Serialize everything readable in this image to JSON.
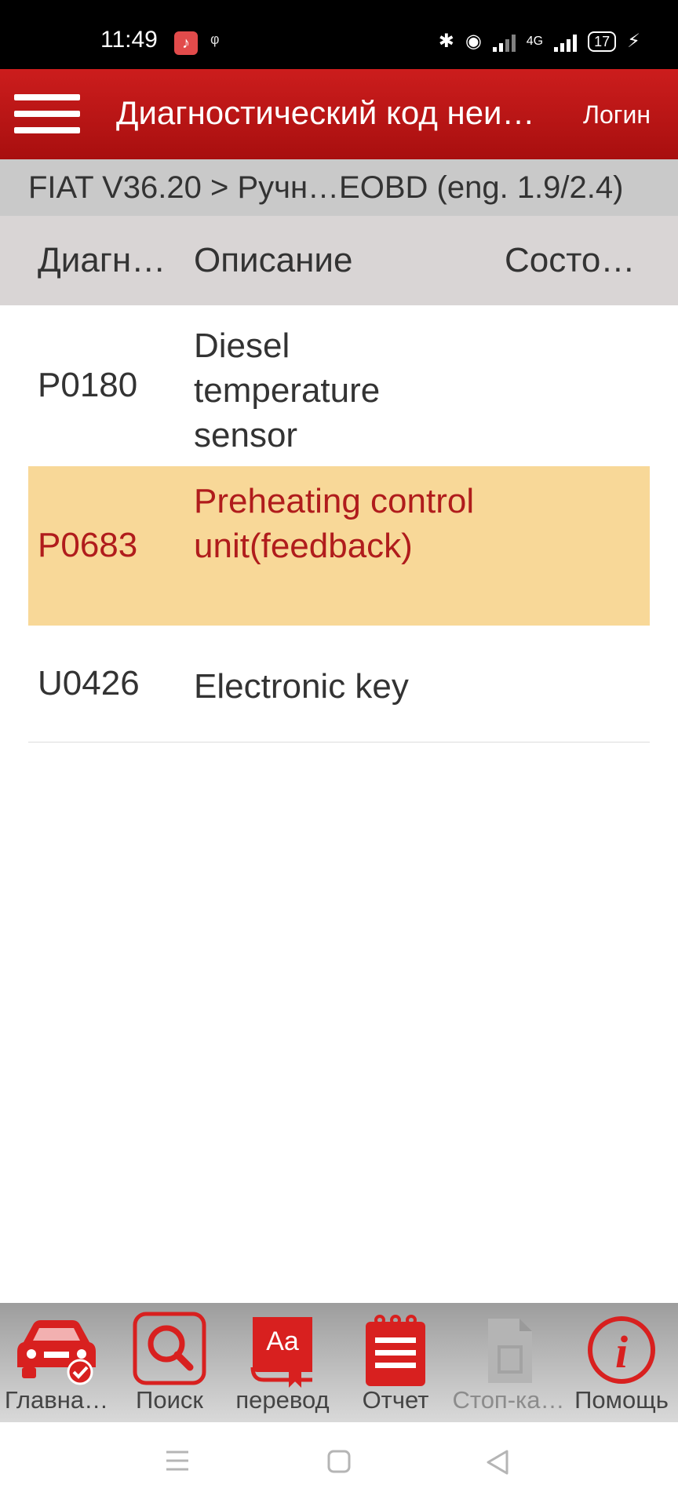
{
  "status_bar": {
    "time": "11:49",
    "network": "4G",
    "battery": "17"
  },
  "header": {
    "title": "Диагностический код неи…",
    "login_label": "Логин"
  },
  "breadcrumb": "FIAT V36.20 > Ручн…EOBD (eng. 1.9/2.4)",
  "table": {
    "columns": [
      "Диагн…",
      "Описание",
      "Состо…"
    ],
    "rows": [
      {
        "code": "P0180",
        "description": "Diesel temperature sensor",
        "status": ""
      },
      {
        "code": "P0683",
        "description": "Preheating control unit(feedback)",
        "status": "",
        "selected": true
      },
      {
        "code": "U0426",
        "description": "Electronic key",
        "status": ""
      }
    ]
  },
  "toolbar": {
    "items": [
      {
        "label": "Главна…",
        "icon": "car-check-icon"
      },
      {
        "label": "Поиск",
        "icon": "search-icon"
      },
      {
        "label": "перевод",
        "icon": "translate-icon"
      },
      {
        "label": "Отчет",
        "icon": "report-icon"
      },
      {
        "label": "Стоп-ка…",
        "icon": "freeze-frame-icon",
        "disabled": true
      },
      {
        "label": "Помощь",
        "icon": "info-icon"
      }
    ]
  },
  "colors": {
    "accent": "#c8161b",
    "selected_row": "#f8d898",
    "selected_text": "#b01c1c"
  }
}
